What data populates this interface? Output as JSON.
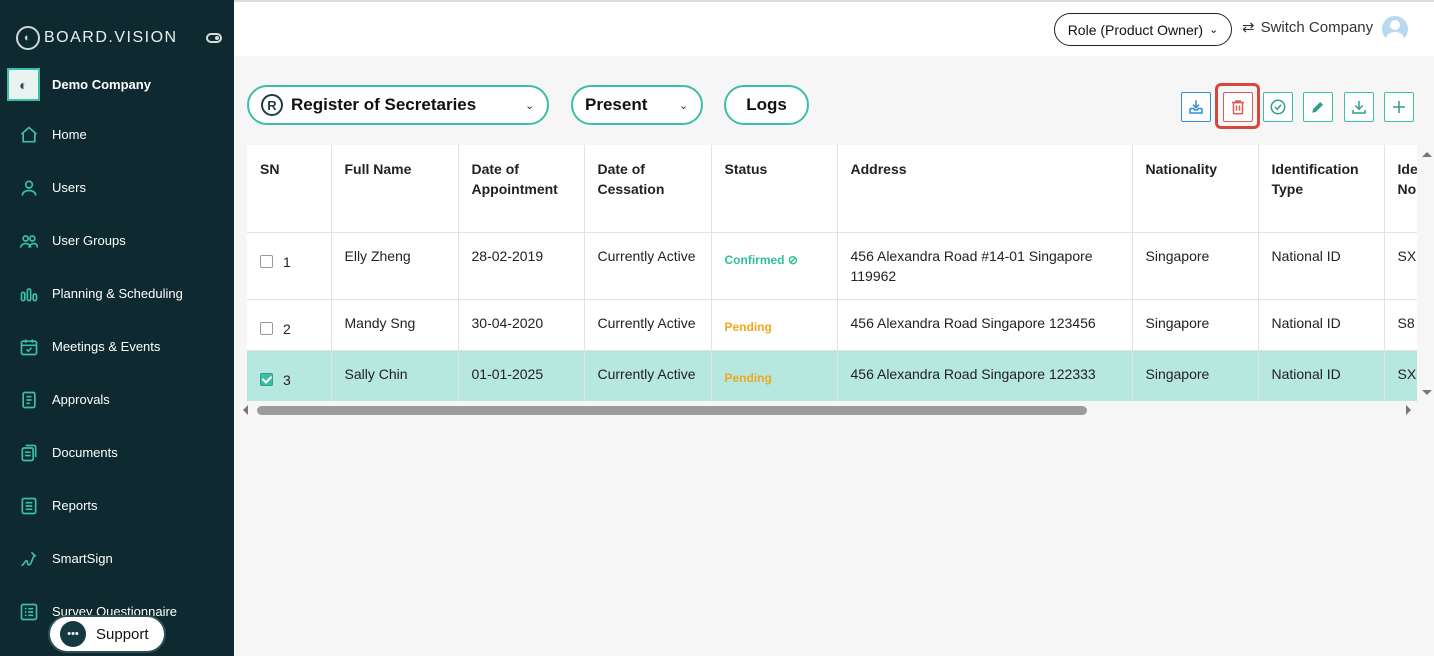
{
  "brand": {
    "name": "BOARD.VISION"
  },
  "company": {
    "name": "Demo Company"
  },
  "sidebar": {
    "items": [
      {
        "label": "Home",
        "icon": "home-icon"
      },
      {
        "label": "Users",
        "icon": "user-icon"
      },
      {
        "label": "User Groups",
        "icon": "user-groups-icon"
      },
      {
        "label": "Planning & Scheduling",
        "icon": "planning-icon"
      },
      {
        "label": "Meetings & Events",
        "icon": "calendar-icon"
      },
      {
        "label": "Approvals",
        "icon": "approvals-icon"
      },
      {
        "label": "Documents",
        "icon": "documents-icon"
      },
      {
        "label": "Reports",
        "icon": "reports-icon"
      },
      {
        "label": "SmartSign",
        "icon": "signature-icon"
      },
      {
        "label": "Survey Questionnaire",
        "icon": "survey-icon"
      }
    ],
    "support_label": "Support"
  },
  "topbar": {
    "role_label": "Role (Product Owner)",
    "switch_label": "Switch Company"
  },
  "toolbar": {
    "register_label": "Register of Secretaries",
    "register_badge": "R",
    "present_label": "Present",
    "logs_label": "Logs"
  },
  "table": {
    "headers": [
      "SN",
      "Full Name",
      "Date of Appointment",
      "Date of Cessation",
      "Status",
      "Address",
      "Nationality",
      "Identification Type",
      "Identification No."
    ],
    "header_lines": [
      [
        "SN"
      ],
      [
        "Full Name"
      ],
      [
        "Date of",
        "Appointment"
      ],
      [
        "Date of",
        "Cessation"
      ],
      [
        "Status"
      ],
      [
        "Address"
      ],
      [
        "Nationality"
      ],
      [
        "Identification",
        "Type"
      ],
      [
        "Ide",
        "No."
      ]
    ],
    "rows": [
      {
        "sn": "1",
        "checked": false,
        "name": "Elly Zheng",
        "appointment": "28-02-2019",
        "cessation": "Currently Active",
        "status": "Confirmed",
        "address": "456 Alexandra Road #14-01 Singapore 119962",
        "nationality": "Singapore",
        "id_type": "National ID",
        "id_no": "SX"
      },
      {
        "sn": "2",
        "checked": false,
        "name": "Mandy Sng",
        "appointment": "30-04-2020",
        "cessation": "Currently Active",
        "status": "Pending",
        "address": "456 Alexandra Road Singapore 123456",
        "nationality": "Singapore",
        "id_type": "National ID",
        "id_no": "S8"
      },
      {
        "sn": "3",
        "checked": true,
        "name": "Sally Chin",
        "appointment": "01-01-2025",
        "cessation": "Currently Active",
        "status": "Pending",
        "address": "456 Alexandra Road Singapore 122333",
        "nationality": "Singapore",
        "id_type": "National ID",
        "id_no": "SX"
      }
    ]
  },
  "colors": {
    "sidebar_bg": "#0e2a30",
    "accent": "#3cbfa8",
    "confirmed": "#2fbf9a",
    "pending": "#f1a81b",
    "selected_row": "#b7e8df",
    "delete_highlight": "#d9463a"
  }
}
